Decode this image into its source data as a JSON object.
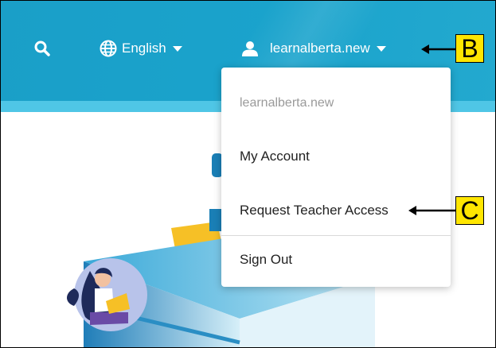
{
  "header": {
    "language_label": "English",
    "user_label": "learnalberta.new"
  },
  "dropdown": {
    "username": "learnalberta.new",
    "items": [
      "My Account",
      "Request Teacher Access",
      "Sign Out"
    ]
  },
  "callouts": {
    "b": "B",
    "c": "C"
  },
  "colors": {
    "header": "#1aa3cc",
    "header_stripe": "#4fc6e6",
    "callout": "#ffe600"
  },
  "icons": [
    "search-icon",
    "globe-icon",
    "chevron-down-icon",
    "user-icon",
    "arrow-left-icon"
  ]
}
